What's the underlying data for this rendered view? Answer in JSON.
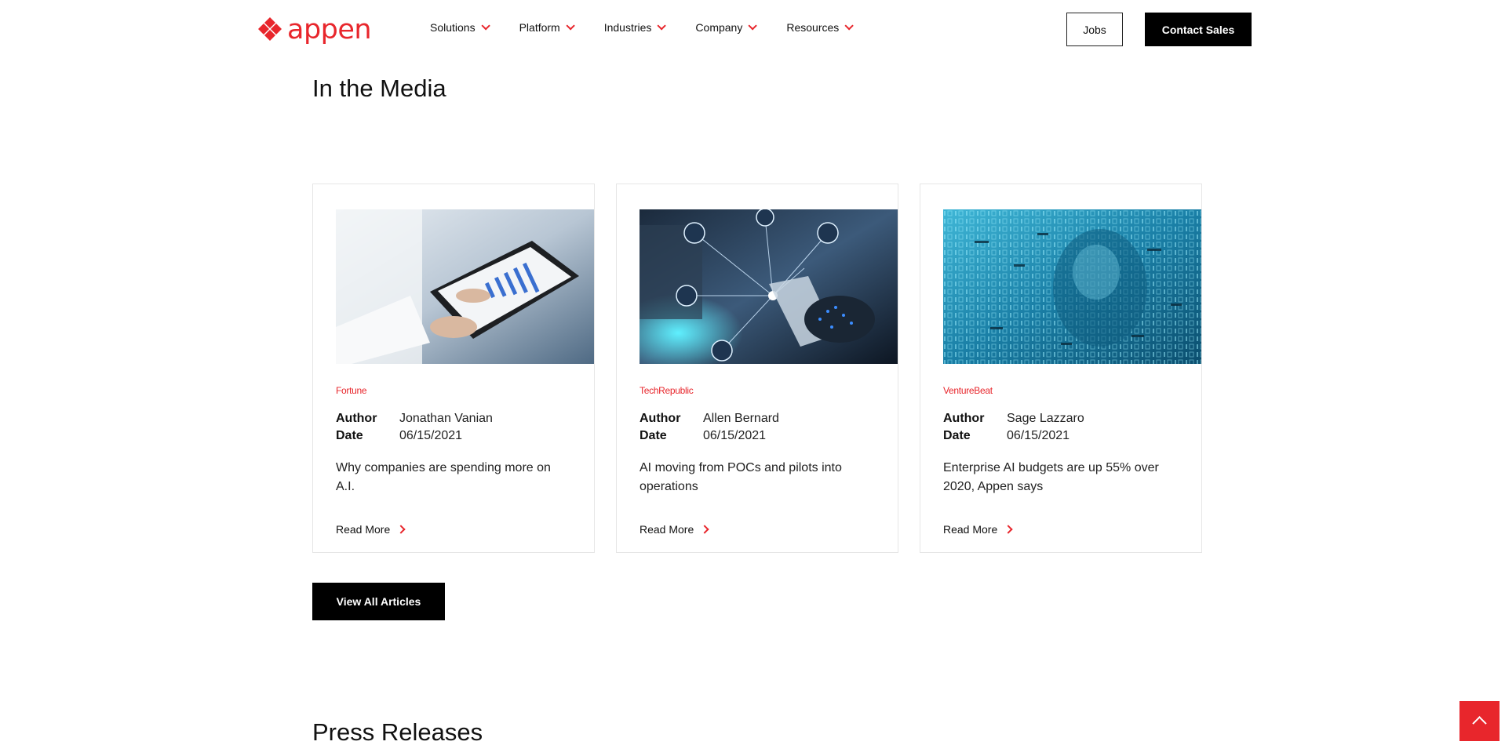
{
  "brand": {
    "logo_text": "appen",
    "accent_color": "#e8262c"
  },
  "nav": {
    "items": [
      {
        "label": "Solutions",
        "icon": "chevron-down-icon"
      },
      {
        "label": "Platform",
        "icon": "chevron-down-icon"
      },
      {
        "label": "Industries",
        "icon": "chevron-down-icon"
      },
      {
        "label": "Company",
        "icon": "chevron-down-icon"
      },
      {
        "label": "Resources",
        "icon": "chevron-down-icon"
      }
    ],
    "jobs_label": "Jobs",
    "contact_label": "Contact Sales"
  },
  "media": {
    "title": "In the Media",
    "author_label": "Author",
    "date_label": "Date",
    "read_more_label": "Read More",
    "articles": [
      {
        "source": "Fortune",
        "author": "Jonathan Vanian",
        "date": "06/15/2021",
        "headline": "Why companies are spending more on A.I."
      },
      {
        "source": "TechRepublic",
        "author": "Allen Bernard",
        "date": "06/15/2021",
        "headline": "AI moving from POCs and pilots into operations"
      },
      {
        "source": "VentureBeat",
        "author": "Sage Lazzaro",
        "date": "06/15/2021",
        "headline": "Enterprise AI budgets are up 55% over 2020, Appen says"
      }
    ],
    "view_all_label": "View All Articles"
  },
  "press": {
    "title": "Press Releases"
  },
  "scroll_top": {
    "icon": "chevron-up-icon"
  }
}
